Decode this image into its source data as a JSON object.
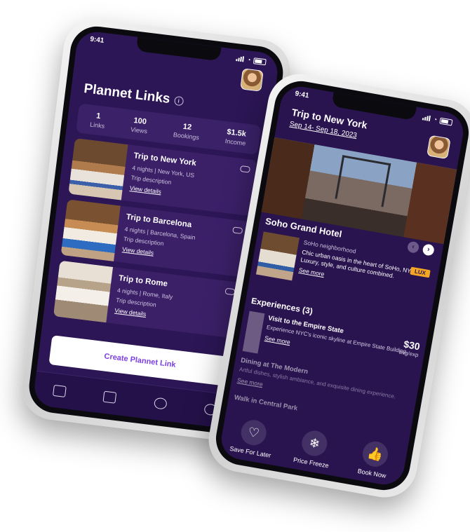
{
  "left_phone": {
    "status_time": "9:41",
    "title": "Plannet Links",
    "info_glyph": "i",
    "stats": [
      {
        "value": "1",
        "label": "Links"
      },
      {
        "value": "100",
        "label": "Views"
      },
      {
        "value": "12",
        "label": "Bookings"
      },
      {
        "value": "$1.5k",
        "label": "Income"
      }
    ],
    "trips": [
      {
        "name": "Trip to New York",
        "meta": "4 nights | New York, US",
        "desc": "Trip description",
        "link": "View details"
      },
      {
        "name": "Trip to Barcelona",
        "meta": "4 nights | Barcelona, Spain",
        "desc": "Trip description",
        "link": "View details"
      },
      {
        "name": "Trip to Rome",
        "meta": "4 nights | Rome, Italy",
        "desc": "Trip description",
        "link": "View details"
      }
    ],
    "create_button": "Create Plannet Link"
  },
  "right_phone": {
    "status_time": "9:41",
    "title": "Trip to New York",
    "dates": "Sep 14- Sep 18, 2023",
    "hotel": {
      "name": "Soho Grand Hotel",
      "prev_glyph": "‹",
      "next_glyph": "›",
      "neighborhood": "SoHo neighborhood",
      "description": "Chic urban oasis in the heart of SoHo, NYC. Luxury, style, and culture combined.",
      "badge": "LUX",
      "see_more": "See more"
    },
    "experiences_title": "Experiences (3)",
    "experiences": [
      {
        "name": "Visit to the Empire State",
        "desc": "Experience NYC's iconic skyline at Empire State Building.",
        "see_more": "See more",
        "price": "$30",
        "unit": "avg/exp"
      },
      {
        "name": "Dining at The Modern",
        "desc": "Artful dishes, stylish ambiance, and exquisite dining experience.",
        "see_more": "See more"
      },
      {
        "name": "Walk in Central Park"
      }
    ],
    "actions": [
      {
        "label": "Save For Later",
        "icon": "heart-icon",
        "glyph": "♡"
      },
      {
        "label": "Price Freeze",
        "icon": "snowflake-icon",
        "glyph": "❄"
      },
      {
        "label": "Book Now",
        "icon": "thumbs-up-icon",
        "glyph": "👍"
      }
    ]
  }
}
